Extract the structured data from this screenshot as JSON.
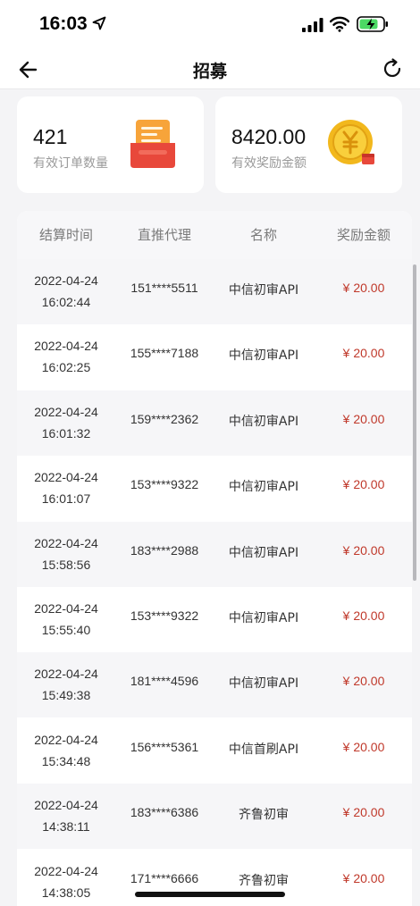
{
  "status_bar": {
    "time": "16:03",
    "icons": [
      "location-arrow-icon",
      "signal-icon",
      "wifi-icon",
      "battery-charging-icon"
    ]
  },
  "nav": {
    "title": "招募",
    "back_icon": "arrow-left-icon",
    "refresh_icon": "refresh-icon"
  },
  "stats": {
    "orders": {
      "value": "421",
      "label": "有效订单数量",
      "icon": "order-box-icon"
    },
    "rewards": {
      "value": "8420.00",
      "label": "有效奖励金额",
      "icon": "yuan-coin-icon"
    }
  },
  "table": {
    "columns": [
      "结算时间",
      "直推代理",
      "名称",
      "奖励金额"
    ],
    "rows": [
      {
        "date": "2022-04-24",
        "time": "16:02:44",
        "agent": "151****5511",
        "name": "中信初审API",
        "amount": "¥ 20.00"
      },
      {
        "date": "2022-04-24",
        "time": "16:02:25",
        "agent": "155****7188",
        "name": "中信初审API",
        "amount": "¥ 20.00"
      },
      {
        "date": "2022-04-24",
        "time": "16:01:32",
        "agent": "159****2362",
        "name": "中信初审API",
        "amount": "¥ 20.00"
      },
      {
        "date": "2022-04-24",
        "time": "16:01:07",
        "agent": "153****9322",
        "name": "中信初审API",
        "amount": "¥ 20.00"
      },
      {
        "date": "2022-04-24",
        "time": "15:58:56",
        "agent": "183****2988",
        "name": "中信初审API",
        "amount": "¥ 20.00"
      },
      {
        "date": "2022-04-24",
        "time": "15:55:40",
        "agent": "153****9322",
        "name": "中信初审API",
        "amount": "¥ 20.00"
      },
      {
        "date": "2022-04-24",
        "time": "15:49:38",
        "agent": "181****4596",
        "name": "中信初审API",
        "amount": "¥ 20.00"
      },
      {
        "date": "2022-04-24",
        "time": "15:34:48",
        "agent": "156****5361",
        "name": "中信首刷API",
        "amount": "¥ 20.00"
      },
      {
        "date": "2022-04-24",
        "time": "14:38:11",
        "agent": "183****6386",
        "name": "齐鲁初审",
        "amount": "¥ 20.00"
      },
      {
        "date": "2022-04-24",
        "time": "14:38:05",
        "agent": "171****6666",
        "name": "齐鲁初审",
        "amount": "¥ 20.00"
      }
    ]
  },
  "colors": {
    "background": "#f4f4f6",
    "amount_red": "#c0392b",
    "coin_gold": "#f2b81d",
    "order_red": "#e8483b"
  }
}
